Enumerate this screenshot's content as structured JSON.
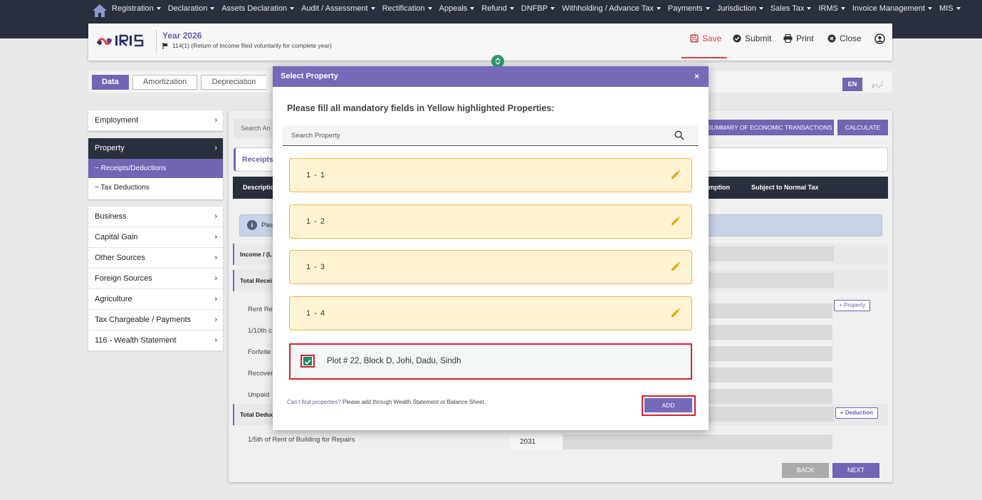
{
  "nav": {
    "items": [
      "Registration",
      "Declaration",
      "Assets Declaration",
      "Audit / Assessment",
      "Rectification",
      "Appeals",
      "Refund",
      "DNFBP",
      "Withholding / Advance Tax",
      "Payments",
      "Jurisdiction",
      "Sales Tax",
      "IRMS",
      "Invoice Management",
      "MIS"
    ]
  },
  "header": {
    "logo_text": "IRIS",
    "year": "Year 2026",
    "return_type": "114(1) (Return of Income filed voluntarily for complete year)",
    "save": "Save",
    "submit": "Submit",
    "print": "Print",
    "close": "Close"
  },
  "tabs": [
    "Data",
    "Amortization",
    "Depreciation"
  ],
  "lang": {
    "en": "EN",
    "ur": "اردو"
  },
  "sidebar": {
    "employment": "Employment",
    "property": "Property",
    "property_subs": [
      "Receipts/Deductions",
      "Tax Deductions"
    ],
    "items": [
      "Business",
      "Capital Gain",
      "Other Sources",
      "Foreign Sources",
      "Agriculture",
      "Tax Chargeable / Payments",
      "116 - Wealth Statement"
    ]
  },
  "main": {
    "search_amount": "Search An",
    "summary_btn": "SUMMARY OF ECONOMIC TRANSACTIONS",
    "calculate_btn": "CALCULATE",
    "receipts_title": "Receipts/",
    "columns": {
      "description": "Descriptio",
      "exemption": "mption",
      "normal": "Subject to Normal Tax"
    },
    "info": "Plea",
    "income_section": "Income / (L",
    "total_receipts": "Total Recei",
    "rows": [
      "Rent Re",
      "1/10th c",
      "Forfeite",
      "Recover",
      "Unpaid"
    ],
    "total_deductions": "Total Deduc",
    "repairs_label": "1/5th of Rent of Building for Repairs",
    "repairs_value": "2031",
    "add_property": "+ Property",
    "add_deduction": "+ Deduction",
    "back": "BACK",
    "next": "NEXT"
  },
  "modal": {
    "title": "Select Property",
    "close": "×",
    "instruction": "Please fill all mandatory fields in Yellow highlighted Properties:",
    "search_placeholder": "Search Property",
    "properties": [
      "1 - 1",
      "1 - 2",
      "1 - 3",
      "1 - 4"
    ],
    "selected_property": "Plot # 22, Block D, Johi, Dadu, Sindh",
    "cant_find_link": "Can't find properties?",
    "cant_find_text": " Please add through Wealth Statement or Balance Sheet.",
    "add": "ADD"
  },
  "colors": {
    "nav_bg": "#2a2f3d",
    "accent": "#7165b4",
    "highlight_red": "#d8202e",
    "yellow_card": "#fff3d4",
    "pencil": "#e6a817"
  }
}
